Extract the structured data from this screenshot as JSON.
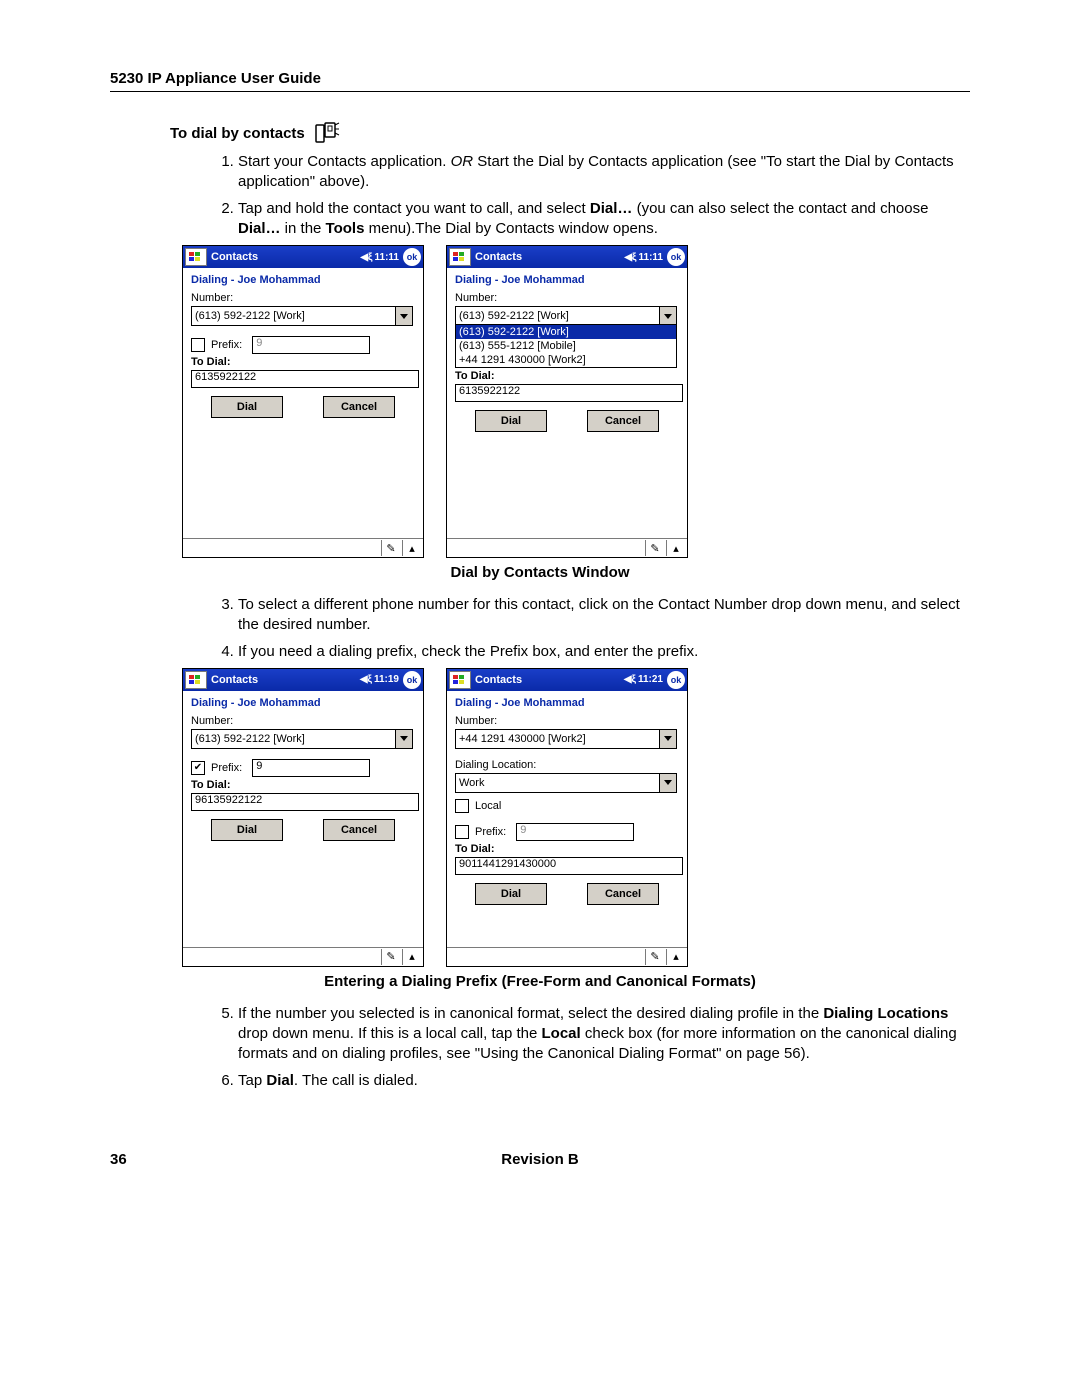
{
  "header": {
    "title": "5230 IP Appliance User Guide"
  },
  "section": {
    "heading": "To dial by contacts"
  },
  "steps": {
    "s1a": "Start your Contacts application. ",
    "s1or": "OR",
    "s1b": "  Start the Dial by Contacts application (see \"To start the Dial by Contacts application\" above).",
    "s2a": "Tap and hold the contact you want to call, and select ",
    "s2b": "Dial…",
    "s2c": " (you can also select the contact and choose ",
    "s2d": "Dial…",
    "s2e": " in the ",
    "s2f": "Tools",
    "s2g": " menu).The Dial by Contacts window opens.",
    "s3": "To select a different phone number for this contact, click on the Contact Number drop down menu, and select the desired number.",
    "s4": "If you need a dialing prefix, check the Prefix box, and enter the prefix.",
    "s5a": "If the number you selected is in canonical format, select the desired dialing profile in the ",
    "s5b": "Dialing Locations",
    "s5c": " drop down menu. If this is a local call, tap the ",
    "s5d": "Local",
    "s5e": " check box (for more information on the canonical dialing formats and on dialing profiles, see \"Using the Canonical Dialing Format\" on page 56).",
    "s6a": "Tap ",
    "s6b": "Dial",
    "s6c": ". The call is dialed."
  },
  "captions": {
    "c1": "Dial by Contacts Window",
    "c2": "Entering a Dialing Prefix (Free-Form and Canonical Formats)"
  },
  "footer": {
    "page": "36",
    "rev": "Revision B"
  },
  "ppc": {
    "app": "Contacts",
    "ok": "ok",
    "dialing": "Dialing - Joe Mohammad",
    "number_label": "Number:",
    "prefix_label": "Prefix:",
    "todial_label": "To Dial:",
    "dial_btn": "Dial",
    "cancel_btn": "Cancel",
    "dialloc_label": "Dialing Location:",
    "local_label": "Local"
  },
  "shots": {
    "a": {
      "time": "11:11",
      "number": "(613) 592-2122 [Work]",
      "prefix_checked": false,
      "prefix_val": "9",
      "todial": "6135922122"
    },
    "b": {
      "time": "11:11",
      "number": "(613) 592-2122 [Work]",
      "opts": [
        "(613) 592-2122 [Work]",
        "(613) 555-1212 [Mobile]",
        "+44 1291 430000 [Work2]"
      ],
      "todial_partial": "To Dial:",
      "todial": "6135922122"
    },
    "c": {
      "time": "11:19",
      "number": "(613) 592-2122 [Work]",
      "prefix_checked": true,
      "prefix_val": "9",
      "todial": "96135922122"
    },
    "d": {
      "time": "11:21",
      "number": "+44 1291 430000 [Work2]",
      "location": "Work",
      "prefix_val": "9",
      "todial": "9011441291430000"
    }
  }
}
